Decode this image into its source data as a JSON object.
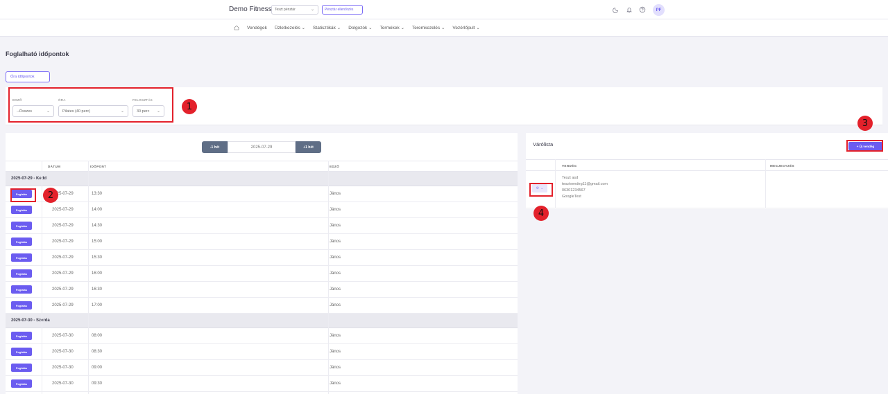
{
  "topbar": {
    "brand": "Demo Fitness",
    "cash_register_select": "Teszt pénztár",
    "cash_check_button": "Pénztár ellenőrzés",
    "avatar_initials": "PF"
  },
  "nav": {
    "items": [
      {
        "label": "Vendégek",
        "dropdown": false
      },
      {
        "label": "Üzletkezelés",
        "dropdown": true
      },
      {
        "label": "Statisztikák",
        "dropdown": true
      },
      {
        "label": "Dolgozók",
        "dropdown": true
      },
      {
        "label": "Termékek",
        "dropdown": true
      },
      {
        "label": "Teremkezelés",
        "dropdown": true
      },
      {
        "label": "Vezérlőpult",
        "dropdown": true
      }
    ]
  },
  "page": {
    "title": "Foglalható időpontok",
    "class_times_button": "Óra időpontok"
  },
  "filters": {
    "trainer_label": "EDZŐ",
    "trainer_value": "--Összes",
    "class_label": "ÓRA",
    "class_value": "Pilates (40 perc)",
    "split_label": "FELOSZTÁS",
    "split_value": "30 perc"
  },
  "markers": [
    "1",
    "2",
    "3",
    "4"
  ],
  "schedule": {
    "prev_week": "-1 hét",
    "date": "2025-07-29",
    "next_week": "+1 hét",
    "columns": {
      "date": "DÁTUM",
      "time": "IDŐPONT",
      "trainer": "EDZŐ"
    },
    "book_label": "Foglalás",
    "groups": [
      {
        "title": "2025-07-29 - Kedd",
        "rows": [
          {
            "date": "2025-07-29",
            "time": "13:30",
            "trainer": "János"
          },
          {
            "date": "2025-07-29",
            "time": "14:00",
            "trainer": "János"
          },
          {
            "date": "2025-07-29",
            "time": "14:30",
            "trainer": "János"
          },
          {
            "date": "2025-07-29",
            "time": "15:00",
            "trainer": "János"
          },
          {
            "date": "2025-07-29",
            "time": "15:30",
            "trainer": "János"
          },
          {
            "date": "2025-07-29",
            "time": "16:00",
            "trainer": "János"
          },
          {
            "date": "2025-07-29",
            "time": "16:30",
            "trainer": "János"
          },
          {
            "date": "2025-07-29",
            "time": "17:00",
            "trainer": "János"
          }
        ]
      },
      {
        "title": "2025-07-30 - Szerda",
        "rows": [
          {
            "date": "2025-07-30",
            "time": "08:00",
            "trainer": "János"
          },
          {
            "date": "2025-07-30",
            "time": "08:30",
            "trainer": "János"
          },
          {
            "date": "2025-07-30",
            "time": "09:00",
            "trainer": "János"
          },
          {
            "date": "2025-07-30",
            "time": "09:30",
            "trainer": "János"
          }
        ]
      }
    ]
  },
  "waitlist": {
    "title": "Várólista",
    "new_guest_button": "+ Új vendég",
    "columns": {
      "guest": "VENDÉG",
      "note": "MEGJEGYZÉS"
    },
    "entries": [
      {
        "name": "Teszt asd",
        "email": "tesztvendeg11@gmail.com",
        "phone": "06301234567",
        "source": "GoogleTest",
        "note": ""
      }
    ]
  },
  "colors": {
    "accent": "#6b5cf0",
    "highlight_red": "#e3212b",
    "week_button": "#5f6e86"
  }
}
